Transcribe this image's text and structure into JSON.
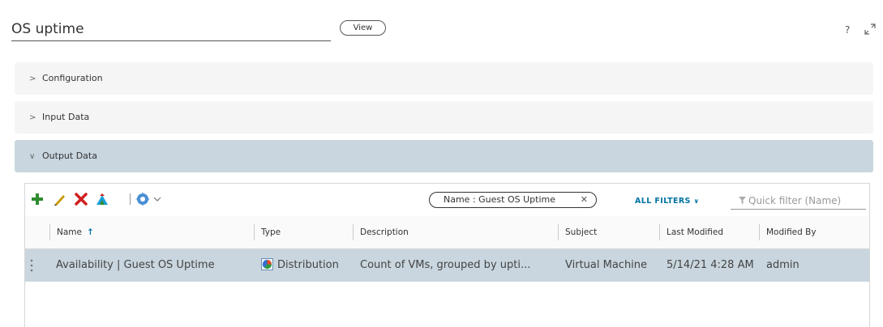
{
  "header": {
    "title": "OS uptime",
    "view_label": "View",
    "help_label": "?"
  },
  "panels": [
    {
      "label": "Configuration",
      "expanded": false
    },
    {
      "label": "Input Data",
      "expanded": false
    },
    {
      "label": "Output Data",
      "expanded": true
    }
  ],
  "toolbar": {
    "icons": [
      "add-icon",
      "edit-icon",
      "delete-icon",
      "import-icon",
      "gear-icon"
    ],
    "filter_pill": "Name : Guest OS Uptime",
    "filter_pill_close": "✕",
    "all_filters_label": "ALL FILTERS",
    "quick_filter_placeholder": "Quick filter (Name)"
  },
  "table": {
    "columns": [
      "Name",
      "Type",
      "Description",
      "Subject",
      "Last Modified",
      "Modified By"
    ],
    "sort_indicator": "↑",
    "rows": [
      {
        "name": "Availability | Guest OS Uptime",
        "type": "Distribution",
        "description": "Count of VMs, grouped by upti...",
        "subject": "Virtual Machine",
        "last_modified": "5/14/21 4:28 AM",
        "modified_by": "admin",
        "selected": true
      }
    ]
  },
  "colors": {
    "accent": "#0072a3",
    "selected_row": "#c9d6df",
    "panel_bg": "#f5f5f5",
    "add_green": "#2e8b2e",
    "delete_red": "#d11f1f",
    "edit_yellow": "#c99a06"
  }
}
